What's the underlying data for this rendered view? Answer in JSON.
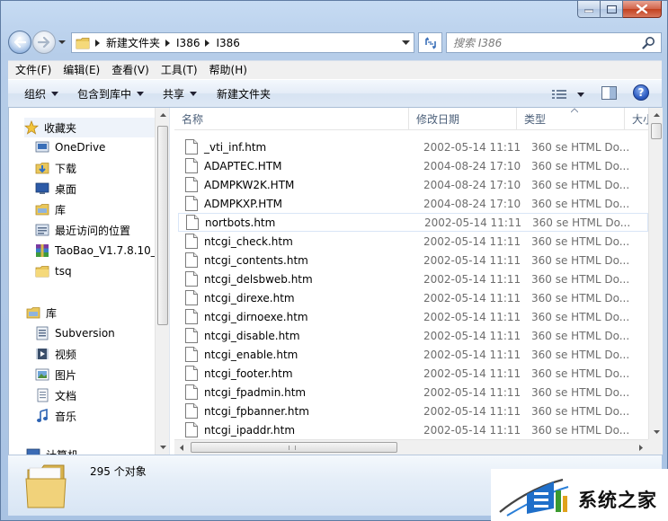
{
  "address": {
    "breadcrumbs": [
      "新建文件夹",
      "I386",
      "I386"
    ],
    "search_placeholder": "搜索 I386"
  },
  "menu": [
    "文件(F)",
    "编辑(E)",
    "查看(V)",
    "工具(T)",
    "帮助(H)"
  ],
  "toolbar": {
    "organize": "组织",
    "include_in_library": "包含到库中",
    "share": "共享",
    "new_folder": "新建文件夹",
    "help": "?"
  },
  "nav": {
    "favorites": {
      "label": "收藏夹",
      "items": [
        {
          "label": "OneDrive",
          "icon": "onedrive-icon"
        },
        {
          "label": "下载",
          "icon": "downloads-icon"
        },
        {
          "label": "桌面",
          "icon": "desktop-icon"
        },
        {
          "label": "库",
          "icon": "library-icon"
        },
        {
          "label": "最近访问的位置",
          "icon": "recent-places-icon"
        },
        {
          "label": "TaoBao_V1.7.8.10_",
          "icon": "archive-icon"
        },
        {
          "label": "tsq",
          "icon": "folder-icon"
        }
      ]
    },
    "libraries": {
      "label": "库",
      "items": [
        {
          "label": "Subversion",
          "icon": "subversion-icon"
        },
        {
          "label": "视频",
          "icon": "videos-icon"
        },
        {
          "label": "图片",
          "icon": "pictures-icon"
        },
        {
          "label": "文档",
          "icon": "documents-icon"
        },
        {
          "label": "音乐",
          "icon": "music-icon"
        }
      ]
    },
    "computer_partial": "计算机"
  },
  "columns": {
    "name": "名称",
    "date": "修改日期",
    "type": "类型",
    "size": "大小"
  },
  "files": [
    {
      "name": "_vti_inf.htm",
      "date": "2002-05-14 11:11",
      "type": "360 se HTML Do..."
    },
    {
      "name": "ADAPTEC.HTM",
      "date": "2004-08-24 17:10",
      "type": "360 se HTML Do..."
    },
    {
      "name": "ADMPKW2K.HTM",
      "date": "2004-08-24 17:10",
      "type": "360 se HTML Do..."
    },
    {
      "name": "ADMPKXP.HTM",
      "date": "2004-08-24 17:10",
      "type": "360 se HTML Do..."
    },
    {
      "name": "nortbots.htm",
      "date": "2002-05-14 11:11",
      "type": "360 se HTML Do..."
    },
    {
      "name": "ntcgi_check.htm",
      "date": "2002-05-14 11:11",
      "type": "360 se HTML Do..."
    },
    {
      "name": "ntcgi_contents.htm",
      "date": "2002-05-14 11:11",
      "type": "360 se HTML Do..."
    },
    {
      "name": "ntcgi_delsbweb.htm",
      "date": "2002-05-14 11:11",
      "type": "360 se HTML Do..."
    },
    {
      "name": "ntcgi_direxe.htm",
      "date": "2002-05-14 11:11",
      "type": "360 se HTML Do..."
    },
    {
      "name": "ntcgi_dirnoexe.htm",
      "date": "2002-05-14 11:11",
      "type": "360 se HTML Do..."
    },
    {
      "name": "ntcgi_disable.htm",
      "date": "2002-05-14 11:11",
      "type": "360 se HTML Do..."
    },
    {
      "name": "ntcgi_enable.htm",
      "date": "2002-05-14 11:11",
      "type": "360 se HTML Do..."
    },
    {
      "name": "ntcgi_footer.htm",
      "date": "2002-05-14 11:11",
      "type": "360 se HTML Do..."
    },
    {
      "name": "ntcgi_fpadmin.htm",
      "date": "2002-05-14 11:11",
      "type": "360 se HTML Do..."
    },
    {
      "name": "ntcgi_fpbanner.htm",
      "date": "2002-05-14 11:11",
      "type": "360 se HTML Do..."
    },
    {
      "name": "ntcgi_ipaddr.htm",
      "date": "2002-05-14 11:11",
      "type": "360 se HTML Do..."
    }
  ],
  "status": {
    "count": "295 个对象"
  },
  "watermark": {
    "text": "系统之家"
  },
  "colors": {
    "accent": "#2f5ec4",
    "window_frame": "#b6cde9",
    "close_button": "#c2411f",
    "secondary_text": "#6d6d6d"
  }
}
